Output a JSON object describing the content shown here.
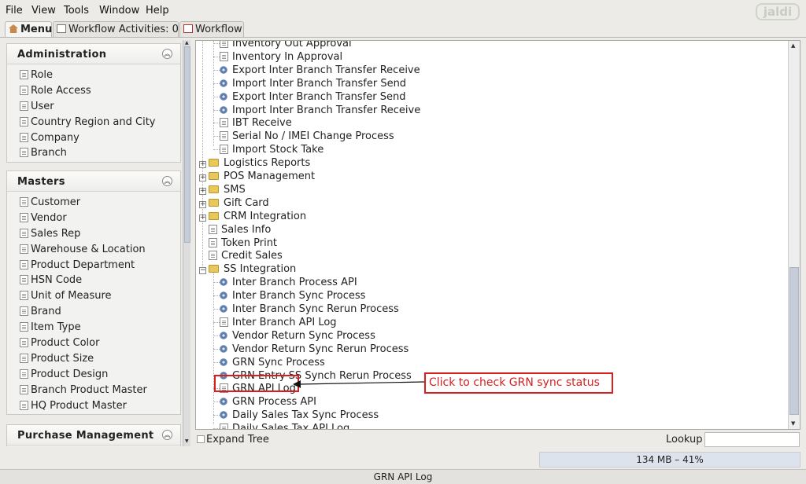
{
  "menubar": {
    "file": "File",
    "view": "View",
    "tools": "Tools",
    "window": "Window",
    "help": "Help",
    "logo": "jaldi"
  },
  "tabs": {
    "menu": "Menu",
    "workflow_activities": "Workflow Activities: 0",
    "workflow": "Workflow"
  },
  "left_panels": [
    {
      "title": "Administration",
      "items": [
        "Role",
        "Role Access",
        "User",
        "Country Region and City",
        "Company",
        "Branch"
      ]
    },
    {
      "title": "Masters",
      "items": [
        "Customer",
        "Vendor",
        "Sales Rep",
        "Warehouse & Location",
        "Product Department",
        "HSN Code",
        "Unit of Measure",
        "Brand",
        "Item Type",
        "Product Color",
        "Product Size",
        "Product Design",
        "Branch Product Master",
        "HQ Product Master"
      ]
    },
    {
      "title": "Purchase Management",
      "items": []
    }
  ],
  "tree": {
    "rows": [
      {
        "label": "Inventory Out Approval",
        "icon": "doc-icon"
      },
      {
        "label": "Inventory In Approval",
        "icon": "doc-icon"
      },
      {
        "label": "Export Inter Branch Transfer Receive",
        "icon": "gear-icon"
      },
      {
        "label": "Import Inter Branch Transfer Send",
        "icon": "gear-icon"
      },
      {
        "label": "Export Inter Branch Transfer Send",
        "icon": "gear-icon"
      },
      {
        "label": "Import Inter Branch Transfer Receive",
        "icon": "gear-icon"
      },
      {
        "label": "IBT Receive",
        "icon": "doc-icon"
      },
      {
        "label": "Serial No / IMEI Change Process",
        "icon": "doc-icon"
      },
      {
        "label": "Import Stock Take",
        "icon": "doc-icon"
      },
      {
        "label": "Logistics Reports",
        "icon": "folder-icon"
      },
      {
        "label": "POS Management",
        "icon": "folder-icon"
      },
      {
        "label": "SMS",
        "icon": "folder-icon"
      },
      {
        "label": "Gift Card",
        "icon": "folder-icon"
      },
      {
        "label": "CRM Integration",
        "icon": "folder-icon"
      },
      {
        "label": "Sales Info",
        "icon": "doc-icon"
      },
      {
        "label": "Token Print",
        "icon": "doc-icon"
      },
      {
        "label": "Credit Sales",
        "icon": "doc-icon"
      },
      {
        "label": "SS Integration",
        "icon": "folder-open-icon"
      },
      {
        "label": "Inter Branch Process API",
        "icon": "gear-icon"
      },
      {
        "label": "Inter Branch Sync Process",
        "icon": "gear-icon"
      },
      {
        "label": "Inter Branch Sync Rerun Process",
        "icon": "gear-icon"
      },
      {
        "label": "Inter Branch API Log",
        "icon": "doc-icon"
      },
      {
        "label": "Vendor Return Sync Process",
        "icon": "gear-icon"
      },
      {
        "label": "Vendor Return Sync Rerun Process",
        "icon": "gear-icon"
      },
      {
        "label": "GRN Sync Process",
        "icon": "gear-icon"
      },
      {
        "label": "GRN Entry SS Synch Rerun Process",
        "icon": "gear-icon"
      },
      {
        "label": "GRN API Log",
        "icon": "doc-icon"
      },
      {
        "label": "GRN Process API",
        "icon": "gear-icon"
      },
      {
        "label": "Daily Sales Tax Sync Process",
        "icon": "gear-icon"
      },
      {
        "label": "Daily Sales Tax API Log",
        "icon": "doc-icon"
      }
    ]
  },
  "callout": "Click to check GRN sync status",
  "bottom": {
    "expand_tree": "Expand Tree",
    "lookup": "Lookup",
    "lookup_value": ""
  },
  "memory": {
    "text": "134 MB – 41%",
    "percent": 41
  },
  "status": "GRN API Log",
  "colors": {
    "highlight": "#d91e1e",
    "folder": "#e9c85b",
    "gear": "#5f7faa"
  }
}
